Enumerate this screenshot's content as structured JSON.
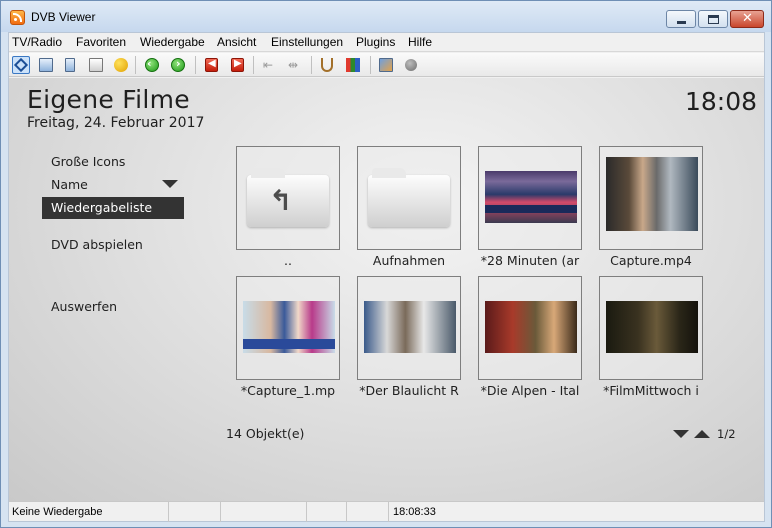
{
  "window": {
    "title": "DVB Viewer"
  },
  "menu": [
    {
      "label": "TV/Radio"
    },
    {
      "label": "Favoriten"
    },
    {
      "label": "Wiedergabe"
    },
    {
      "label": "Ansicht"
    },
    {
      "label": "Einstellungen"
    },
    {
      "label": "Plugins"
    },
    {
      "label": "Hilfe"
    }
  ],
  "toolbar": {
    "icons": [
      "osd-icon",
      "tv-icon",
      "copy-icon",
      "monitor-icon",
      "weather-icon",
      "back-icon",
      "forward-icon",
      "prev-icon",
      "next-icon",
      "rewind-icon",
      "fastforward-icon",
      "timeshift-icon",
      "equalizer-icon",
      "picture-icon",
      "record-icon"
    ]
  },
  "header": {
    "title": "Eigene Filme",
    "date": "Freitag, 24. Februar 2017",
    "clock": "18:08"
  },
  "sidebar": {
    "items": [
      {
        "label": "Große Icons"
      },
      {
        "label": "Name"
      },
      {
        "label": "Wiedergabeliste"
      },
      {
        "label": "DVD abspielen"
      },
      {
        "label": "Auswerfen"
      }
    ]
  },
  "grid": {
    "items": [
      {
        "label": "..",
        "kind": "parent-folder"
      },
      {
        "label": "Aufnahmen",
        "kind": "folder"
      },
      {
        "label": "*28 Minuten (ar",
        "kind": "video"
      },
      {
        "label": "Capture.mp4",
        "kind": "video"
      },
      {
        "label": "*Capture_1.mp",
        "kind": "video"
      },
      {
        "label": "*Der Blaulicht R",
        "kind": "video"
      },
      {
        "label": "*Die Alpen - Ital",
        "kind": "video"
      },
      {
        "label": "*FilmMittwoch i",
        "kind": "video"
      }
    ],
    "count": "14 Objekt(e)",
    "page": "1/2"
  },
  "status": {
    "playback": "Keine Wiedergabe",
    "time": "18:08:33"
  },
  "colors": {
    "selected_bg": "#333333",
    "panel_bg": "#dddddd"
  }
}
